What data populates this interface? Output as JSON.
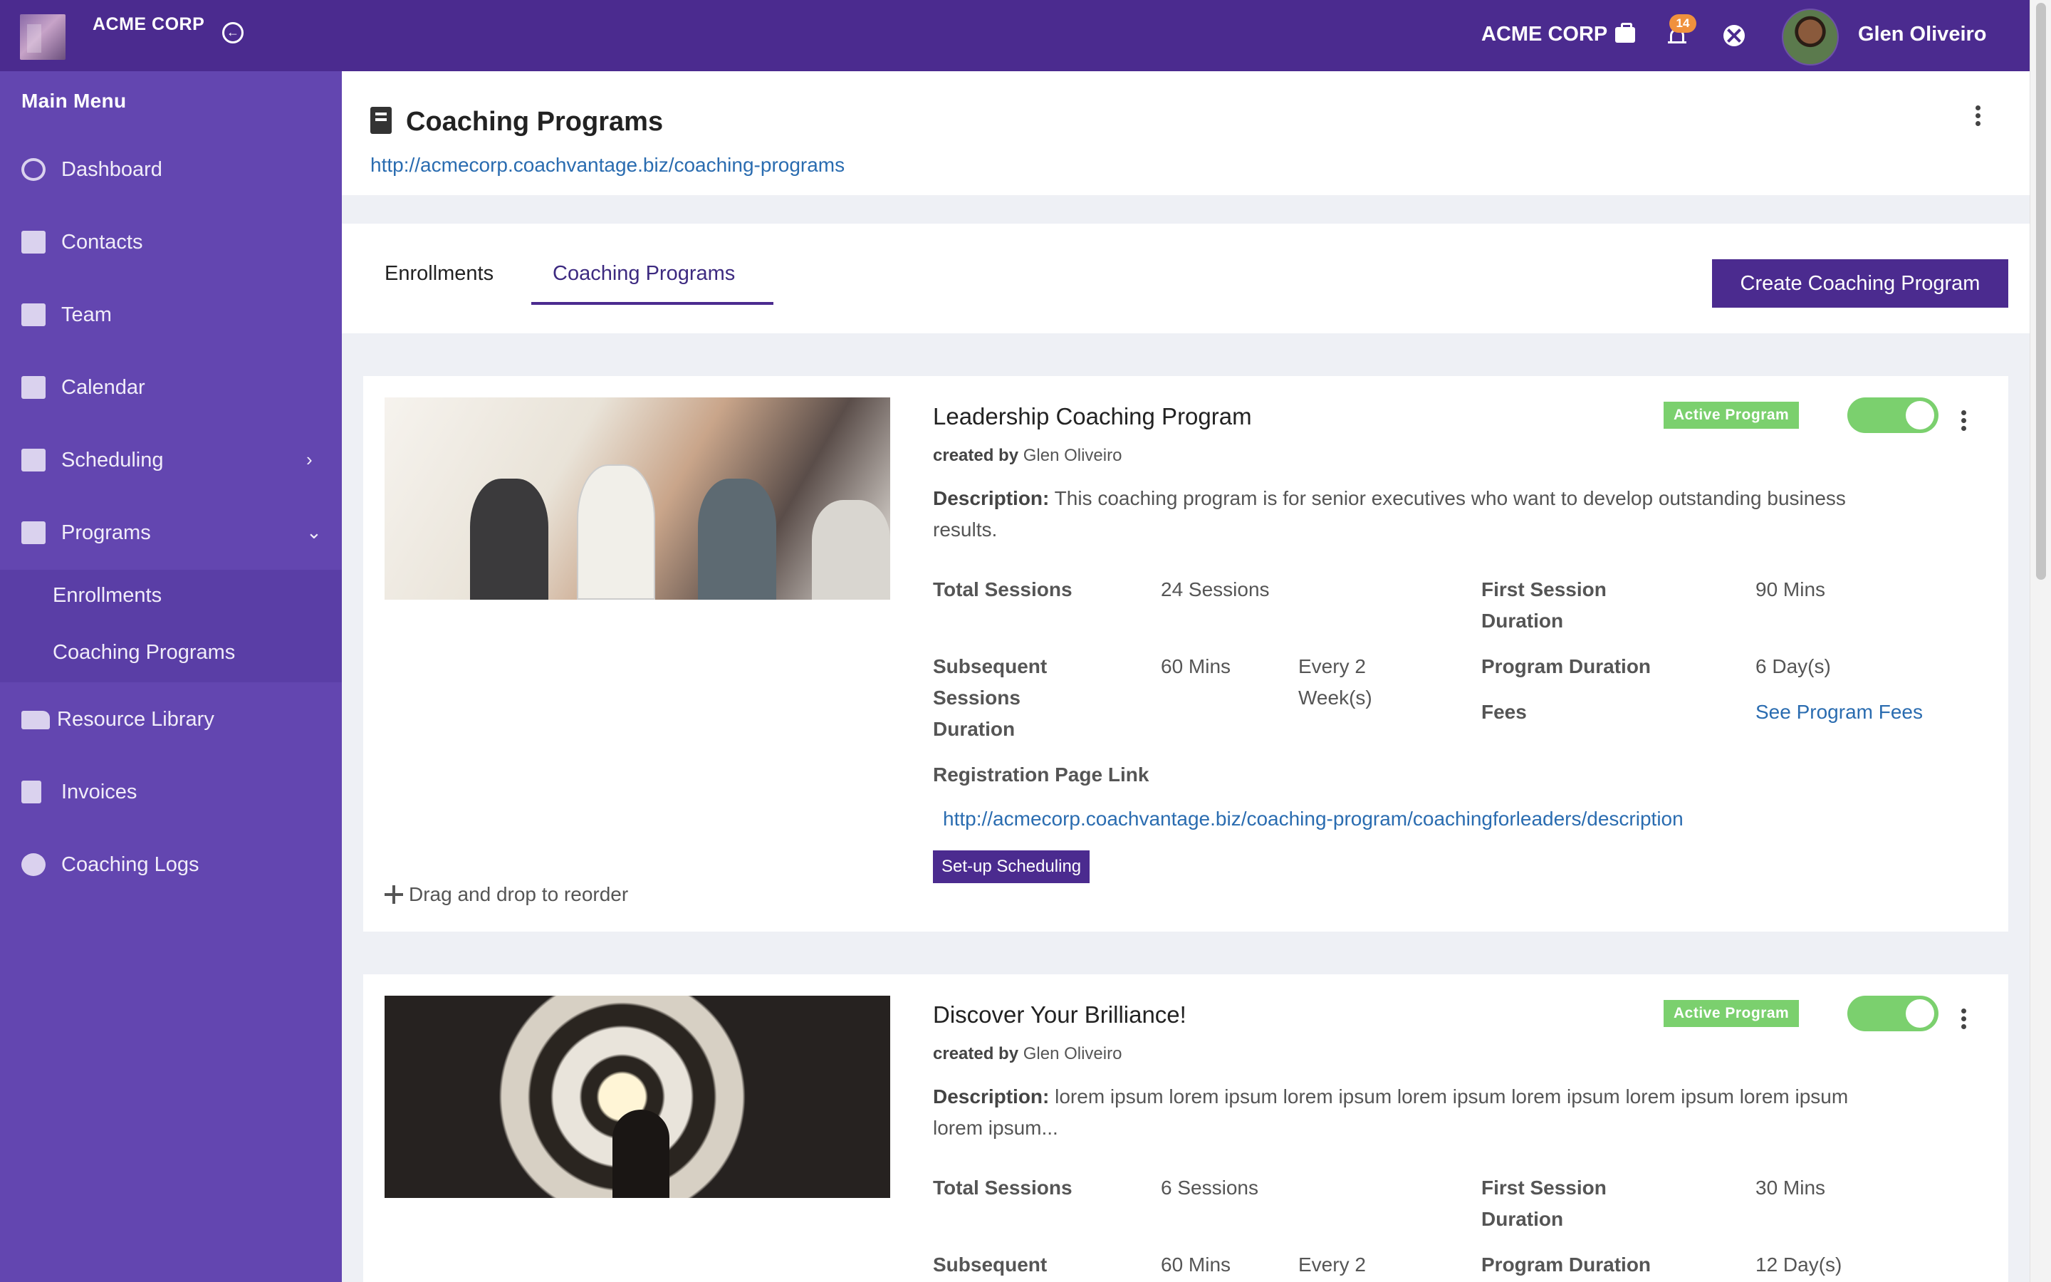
{
  "header": {
    "brand": "ACME CORP",
    "org_name": "ACME CORP",
    "notification_count": "14",
    "user_name": "Glen Oliveiro"
  },
  "sidebar": {
    "section_label": "Main Menu",
    "items": [
      {
        "label": "Dashboard",
        "icon": "dashboard-icon"
      },
      {
        "label": "Contacts",
        "icon": "contacts-icon"
      },
      {
        "label": "Team",
        "icon": "team-icon"
      },
      {
        "label": "Calendar",
        "icon": "calendar-icon"
      },
      {
        "label": "Scheduling",
        "icon": "scheduling-icon"
      },
      {
        "label": "Programs",
        "icon": "programs-icon"
      },
      {
        "label": "Resource Library",
        "icon": "folder-icon"
      },
      {
        "label": "Invoices",
        "icon": "invoice-icon"
      },
      {
        "label": "Coaching Logs",
        "icon": "clock-icon"
      }
    ],
    "programs_sub": [
      {
        "label": "Enrollments"
      },
      {
        "label": "Coaching Programs"
      }
    ]
  },
  "page": {
    "title": "Coaching Programs",
    "url": "http://acmecorp.coachvantage.biz/coaching-programs"
  },
  "tabs": [
    {
      "label": "Enrollments"
    },
    {
      "label": "Coaching Programs",
      "active": true
    }
  ],
  "create_button": "Create Coaching Program",
  "labels": {
    "created_by": "created by",
    "description": "Description:",
    "total_sessions": "Total Sessions",
    "first_session_line1": "First Session",
    "first_session_line2": "Duration",
    "subsequent_line1": "Subsequent",
    "subsequent_line2": "Sessions",
    "subsequent_line3": "Duration",
    "program_duration": "Program Duration",
    "fees": "Fees",
    "registration_link": "Registration Page Link",
    "drag_hint": "Drag and drop to reorder"
  },
  "programs": [
    {
      "title": "Leadership Coaching Program",
      "status": "Active Program",
      "active": true,
      "created_by": "Glen Oliveiro",
      "description": "This coaching program is for senior executives who want to develop outstanding business results.",
      "total_sessions": "24 Sessions",
      "first_session_duration": "90 Mins",
      "subsequent_duration": "60 Mins",
      "frequency_line1": "Every 2",
      "frequency_line2": "Week(s)",
      "program_duration": "6 Day(s)",
      "fees_link": "See Program Fees",
      "registration_url": "http://acmecorp.coachvantage.biz/coaching-program/coachingforleaders/description",
      "setup_button": "Set-up Scheduling"
    },
    {
      "title": "Discover Your Brilliance!",
      "status": "Active Program",
      "active": true,
      "created_by": "Glen Oliveiro",
      "description": "lorem ipsum lorem ipsum lorem ipsum lorem ipsum lorem ipsum lorem ipsum lorem ipsum lorem ipsum...",
      "total_sessions": "6 Sessions",
      "first_session_duration": "30 Mins",
      "subsequent_duration": "60 Mins",
      "frequency_line1": "Every 2",
      "program_duration": "12 Day(s)"
    }
  ]
}
